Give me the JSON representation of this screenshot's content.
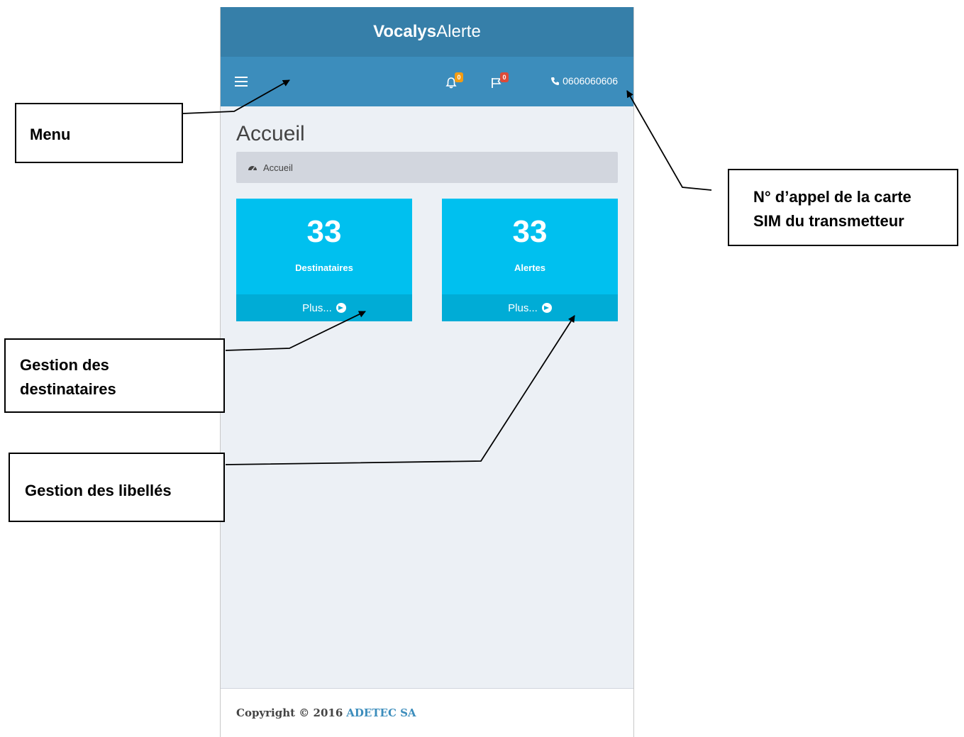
{
  "app": {
    "brand_bold": "Vocalys",
    "brand_regular": "Alerte"
  },
  "navbar": {
    "menu_icon": "hamburger-icon",
    "notifications": {
      "icon": "bell-icon",
      "count": "0",
      "color": "#f39c12"
    },
    "flags": {
      "icon": "flag-icon",
      "count": "0",
      "color": "#dd4b39"
    },
    "phone": {
      "icon": "phone-icon",
      "number": "0606060606"
    }
  },
  "page": {
    "title": "Accueil",
    "breadcrumb": {
      "icon": "dashboard-icon",
      "label": "Accueil"
    }
  },
  "boxes": [
    {
      "value": "33",
      "label": "Destinataires",
      "more": "Plus..."
    },
    {
      "value": "33",
      "label": "Alertes",
      "more": "Plus..."
    }
  ],
  "footer": {
    "copyright": "Copyright © 2016",
    "company": "ADETEC SA"
  },
  "annotations": {
    "menu": "Menu",
    "sim_line1": "N° d’appel de la carte",
    "sim_line2": "SIM du transmetteur",
    "recipients_line1": "Gestion des",
    "recipients_line2": "destinataires",
    "labels": "Gestion des libellés"
  },
  "colors": {
    "brand_bar": "#367fa9",
    "navbar": "#3c8dbc",
    "info_box": "#00c0ef",
    "info_box_footer": "#00acd6",
    "content_bg": "#ecf0f5"
  }
}
